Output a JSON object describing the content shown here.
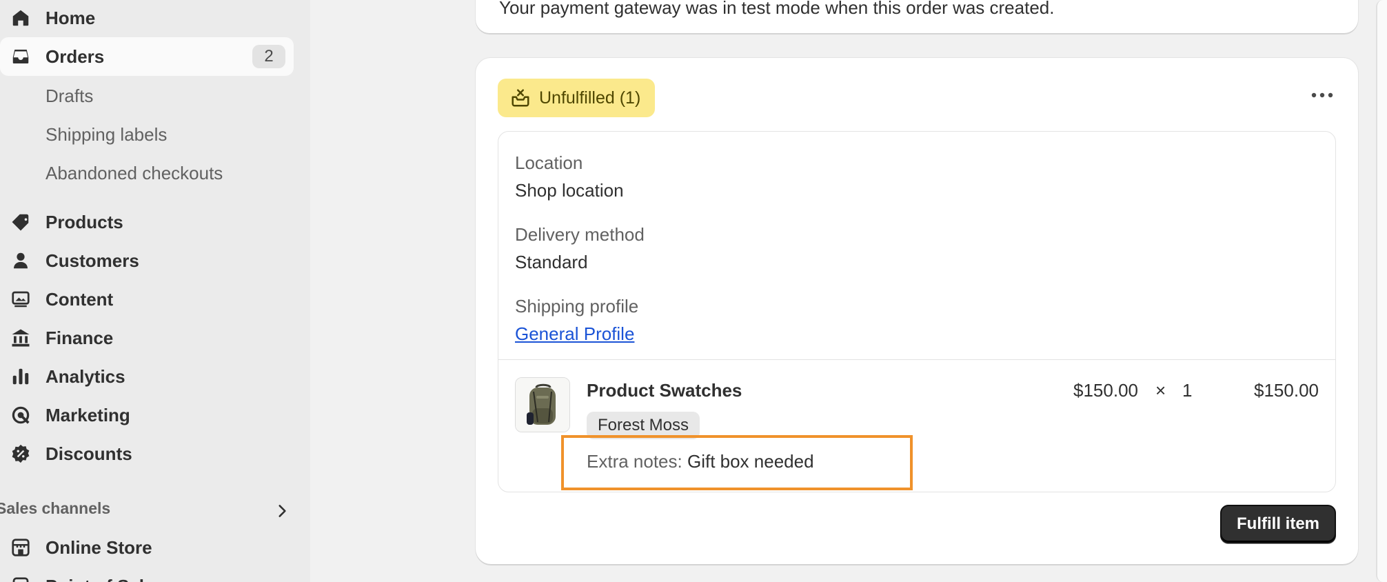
{
  "sidebar": {
    "items": [
      {
        "label": "Home",
        "icon": "home-icon"
      },
      {
        "label": "Orders",
        "icon": "inbox-icon",
        "badge": "2",
        "active": true
      },
      {
        "label": "Products",
        "icon": "tag-icon"
      },
      {
        "label": "Customers",
        "icon": "person-icon"
      },
      {
        "label": "Content",
        "icon": "image-icon"
      },
      {
        "label": "Finance",
        "icon": "bank-icon"
      },
      {
        "label": "Analytics",
        "icon": "bar-chart-icon"
      },
      {
        "label": "Marketing",
        "icon": "target-icon"
      },
      {
        "label": "Discounts",
        "icon": "discount-icon"
      }
    ],
    "sub_items": [
      "Drafts",
      "Shipping labels",
      "Abandoned checkouts"
    ],
    "sales_channels_title": "Sales channels",
    "channels": [
      {
        "label": "Online Store",
        "icon": "store-icon"
      },
      {
        "label": "Point of Sale",
        "icon": "pos-icon"
      }
    ]
  },
  "top_card": {
    "text": "Your payment gateway was in test mode when this order was created."
  },
  "fulfillment": {
    "status": "Unfulfilled (1)",
    "status_icon": "unfulfilled-box-icon",
    "status_color": "#fbe98c",
    "location_label": "Location",
    "location_value": "Shop location",
    "delivery_label": "Delivery method",
    "delivery_value": "Standard",
    "profile_label": "Shipping profile",
    "profile_link": "General Profile",
    "line_item": {
      "name": "Product Swatches",
      "variant": "Forest Moss",
      "notes_label": "Extra notes:",
      "notes_value": "Gift box needed",
      "price": "$150.00",
      "times": "×",
      "quantity": "1",
      "total": "$150.00"
    },
    "fulfill_button": "Fulfill item"
  }
}
